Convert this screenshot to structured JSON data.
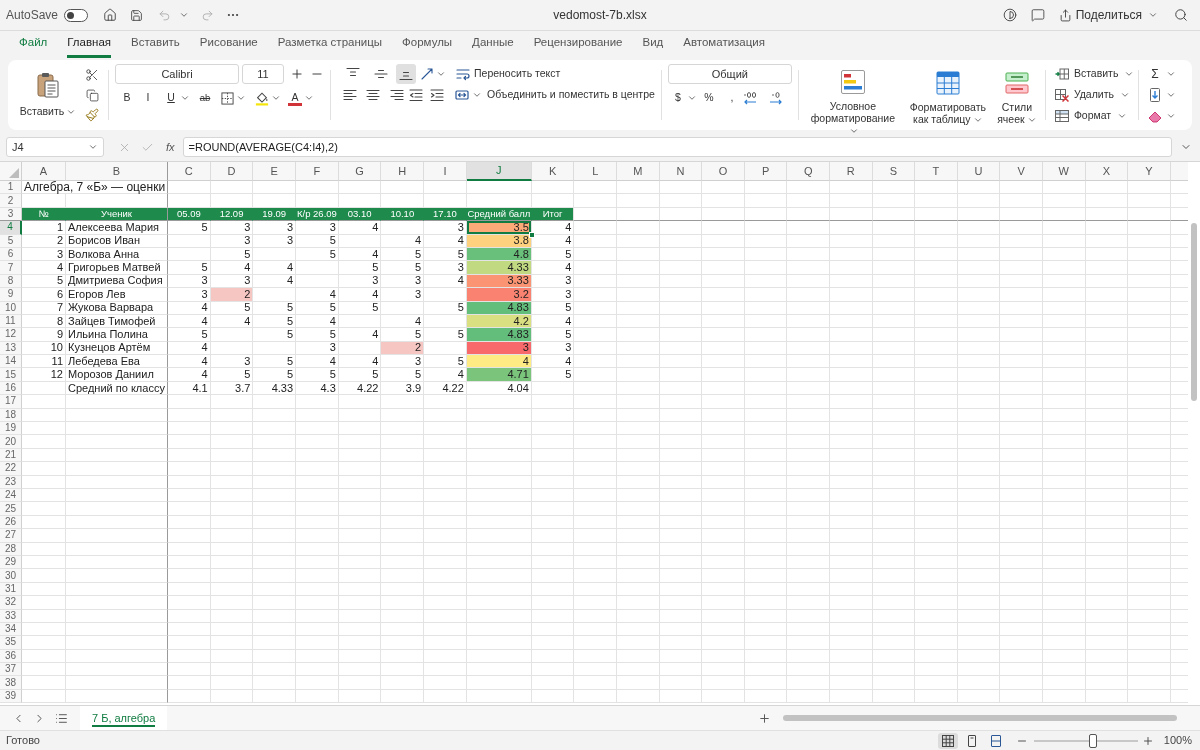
{
  "title_bar": {
    "autosave_label": "AutoSave",
    "autosave_on": false,
    "file_name": "vedomost-7b.xlsx",
    "share_label": "Поделиться"
  },
  "menu_tabs": [
    {
      "label": "Файл",
      "selected": false,
      "kind": "file"
    },
    {
      "label": "Главная",
      "selected": true,
      "kind": "tab"
    },
    {
      "label": "Вставить",
      "selected": false,
      "kind": "tab"
    },
    {
      "label": "Рисование",
      "selected": false,
      "kind": "tab"
    },
    {
      "label": "Разметка страницы",
      "selected": false,
      "kind": "tab"
    },
    {
      "label": "Формулы",
      "selected": false,
      "kind": "tab"
    },
    {
      "label": "Данные",
      "selected": false,
      "kind": "tab"
    },
    {
      "label": "Рецензирование",
      "selected": false,
      "kind": "tab"
    },
    {
      "label": "Вид",
      "selected": false,
      "kind": "tab"
    },
    {
      "label": "Автоматизация",
      "selected": false,
      "kind": "tab"
    }
  ],
  "ribbon": {
    "paste_label": "Вставить",
    "font_name": "Calibri",
    "font_size": "11",
    "font_glyphs": {
      "bold": "B",
      "italic": "I",
      "underline": "U",
      "strikethrough": "ab",
      "font_color": "A"
    },
    "vertical_align": [
      {
        "kind": "top",
        "selected": false
      },
      {
        "kind": "middle",
        "selected": false
      },
      {
        "kind": "bottom",
        "selected": true
      }
    ],
    "wrap_text_label": "Переносить текст",
    "merge_label": "Объединить и поместить в центре",
    "number_format": "Общий",
    "number_glyphs": {
      "currency": "$",
      "percent": "%",
      "comma": ","
    },
    "conditional_formatting_label": "Условное форматирование",
    "format_as_table_label": "Форматировать как таблицу",
    "cell_styles_label": "Стили ячеек",
    "cell_actions": [
      {
        "kind": "insert",
        "label": "Вставить"
      },
      {
        "kind": "delete",
        "label": "Удалить"
      },
      {
        "kind": "format",
        "label": "Формат"
      }
    ],
    "sum_glyph": "Σ"
  },
  "formula_bar": {
    "name_box": "J4",
    "fx_label": "fx",
    "formula": "=ROUND(AVERAGE(C4:I4),2)"
  },
  "sheet": {
    "columns": [
      {
        "label": "A",
        "selected": false
      },
      {
        "label": "B",
        "selected": false
      },
      {
        "label": "C",
        "selected": false
      },
      {
        "label": "D",
        "selected": false
      },
      {
        "label": "E",
        "selected": false
      },
      {
        "label": "F",
        "selected": false
      },
      {
        "label": "G",
        "selected": false
      },
      {
        "label": "H",
        "selected": false
      },
      {
        "label": "I",
        "selected": false
      },
      {
        "label": "J",
        "selected": true
      },
      {
        "label": "K",
        "selected": false
      },
      {
        "label": "L",
        "selected": false
      },
      {
        "label": "M",
        "selected": false
      },
      {
        "label": "N",
        "selected": false
      },
      {
        "label": "O",
        "selected": false
      },
      {
        "label": "P",
        "selected": false
      },
      {
        "label": "Q",
        "selected": false
      },
      {
        "label": "R",
        "selected": false
      },
      {
        "label": "S",
        "selected": false
      },
      {
        "label": "T",
        "selected": false
      },
      {
        "label": "U",
        "selected": false
      },
      {
        "label": "V",
        "selected": false
      },
      {
        "label": "W",
        "selected": false
      },
      {
        "label": "X",
        "selected": false
      },
      {
        "label": "Y",
        "selected": false
      }
    ],
    "rows": [
      {
        "label": "1",
        "selected": false,
        "kind": "title",
        "cells": [
          {
            "text": "Алгебра, 7 «Б» — оценки"
          }
        ]
      },
      {
        "label": "2",
        "selected": false,
        "kind": "empty"
      },
      {
        "label": "3",
        "selected": false,
        "kind": "header",
        "cells": [
          {
            "text": "№"
          },
          {
            "text": "Ученик"
          },
          {
            "text": "05.09"
          },
          {
            "text": "12.09"
          },
          {
            "text": "19.09"
          },
          {
            "text": "К/р 26.09"
          },
          {
            "text": "03.10"
          },
          {
            "text": "10.10"
          },
          {
            "text": "17.10"
          },
          {
            "text": "Средний балл"
          },
          {
            "text": "Итог"
          }
        ]
      },
      {
        "label": "4",
        "selected": true,
        "kind": "data",
        "cells": [
          {
            "text": "1"
          },
          {
            "text": "Алексеева Мария"
          },
          {
            "text": "5"
          },
          {
            "text": "3"
          },
          {
            "text": "3"
          },
          {
            "text": "3"
          },
          {
            "text": "4"
          },
          null,
          {
            "text": "3"
          },
          {
            "text": "3.5",
            "color": "#fcaa78"
          },
          {
            "text": "4"
          }
        ]
      },
      {
        "label": "5",
        "selected": false,
        "kind": "data",
        "cells": [
          {
            "text": "2"
          },
          {
            "text": "Борисов Иван"
          },
          null,
          {
            "text": "3"
          },
          {
            "text": "3"
          },
          {
            "text": "5"
          },
          null,
          {
            "text": "4"
          },
          {
            "text": "4"
          },
          {
            "text": "3.8",
            "color": "#fed17f"
          },
          {
            "text": "4"
          }
        ]
      },
      {
        "label": "6",
        "selected": false,
        "kind": "data",
        "cells": [
          {
            "text": "3"
          },
          {
            "text": "Волкова Анна"
          },
          null,
          {
            "text": "5"
          },
          null,
          {
            "text": "5"
          },
          {
            "text": "4"
          },
          {
            "text": "5"
          },
          {
            "text": "5"
          },
          {
            "text": "4.8",
            "color": "#69c07b"
          },
          {
            "text": "5"
          }
        ]
      },
      {
        "label": "7",
        "selected": false,
        "kind": "data",
        "cells": [
          {
            "text": "4"
          },
          {
            "text": "Григорьев Матвей"
          },
          {
            "text": "5"
          },
          {
            "text": "4"
          },
          {
            "text": "4"
          },
          null,
          {
            "text": "5"
          },
          {
            "text": "5"
          },
          {
            "text": "3"
          },
          {
            "text": "4.33",
            "color": "#c1d980"
          },
          {
            "text": "4"
          }
        ]
      },
      {
        "label": "8",
        "selected": false,
        "kind": "data",
        "cells": [
          {
            "text": "5"
          },
          {
            "text": "Дмитриева София"
          },
          {
            "text": "3"
          },
          {
            "text": "3"
          },
          {
            "text": "4"
          },
          null,
          {
            "text": "3"
          },
          {
            "text": "3"
          },
          {
            "text": "4"
          },
          {
            "text": "3.33",
            "color": "#fa9473"
          },
          {
            "text": "3"
          }
        ]
      },
      {
        "label": "9",
        "selected": false,
        "kind": "data",
        "cells": [
          {
            "text": "6"
          },
          {
            "text": "Егоров Лев"
          },
          {
            "text": "3"
          },
          {
            "text": "2",
            "color": "#f5c6c2"
          },
          null,
          {
            "text": "4"
          },
          {
            "text": "4"
          },
          {
            "text": "3"
          },
          null,
          {
            "text": "3.2",
            "color": "#f98370"
          },
          {
            "text": "3"
          }
        ]
      },
      {
        "label": "10",
        "selected": false,
        "kind": "data",
        "cells": [
          {
            "text": "7"
          },
          {
            "text": "Жукова Варвара"
          },
          {
            "text": "4"
          },
          {
            "text": "5"
          },
          {
            "text": "5"
          },
          {
            "text": "5"
          },
          {
            "text": "5"
          },
          null,
          {
            "text": "5"
          },
          {
            "text": "4.83",
            "color": "#63be7b"
          },
          {
            "text": "5"
          }
        ]
      },
      {
        "label": "11",
        "selected": false,
        "kind": "data",
        "cells": [
          {
            "text": "8"
          },
          {
            "text": "Зайцев Тимофей"
          },
          {
            "text": "4"
          },
          {
            "text": "4"
          },
          {
            "text": "5"
          },
          {
            "text": "4"
          },
          null,
          {
            "text": "4"
          },
          null,
          {
            "text": "4.2",
            "color": "#dae082"
          },
          {
            "text": "4"
          }
        ]
      },
      {
        "label": "12",
        "selected": false,
        "kind": "data",
        "cells": [
          {
            "text": "9"
          },
          {
            "text": "Ильина Полина"
          },
          {
            "text": "5"
          },
          null,
          {
            "text": "5"
          },
          {
            "text": "5"
          },
          {
            "text": "4"
          },
          {
            "text": "5"
          },
          {
            "text": "5"
          },
          {
            "text": "4.83",
            "color": "#63be7b"
          },
          {
            "text": "5"
          }
        ]
      },
      {
        "label": "13",
        "selected": false,
        "kind": "data",
        "cells": [
          {
            "text": "10"
          },
          {
            "text": "Кузнецов Артём"
          },
          {
            "text": "4"
          },
          null,
          null,
          {
            "text": "3"
          },
          null,
          {
            "text": "2",
            "color": "#f5c6c2"
          },
          null,
          {
            "text": "3",
            "color": "#f8696b"
          },
          {
            "text": "3"
          }
        ]
      },
      {
        "label": "14",
        "selected": false,
        "kind": "data",
        "cells": [
          {
            "text": "11"
          },
          {
            "text": "Лебедева Ева"
          },
          {
            "text": "4"
          },
          {
            "text": "3"
          },
          {
            "text": "5"
          },
          {
            "text": "4"
          },
          {
            "text": "4"
          },
          {
            "text": "3"
          },
          {
            "text": "5"
          },
          {
            "text": "4",
            "color": "#ffeb84"
          },
          {
            "text": "4"
          }
        ]
      },
      {
        "label": "15",
        "selected": false,
        "kind": "data",
        "cells": [
          {
            "text": "12"
          },
          {
            "text": "Морозов Даниил"
          },
          {
            "text": "4"
          },
          {
            "text": "5"
          },
          {
            "text": "5"
          },
          {
            "text": "5"
          },
          {
            "text": "5"
          },
          {
            "text": "5"
          },
          {
            "text": "4"
          },
          {
            "text": "4.71",
            "color": "#7ac47c"
          },
          {
            "text": "5"
          }
        ]
      },
      {
        "label": "16",
        "selected": false,
        "kind": "data",
        "cells": [
          null,
          {
            "text": "Средний по классу"
          },
          {
            "text": "4.1"
          },
          {
            "text": "3.7"
          },
          {
            "text": "4.33"
          },
          {
            "text": "4.3"
          },
          {
            "text": "4.22"
          },
          {
            "text": "3.9"
          },
          {
            "text": "4.22"
          },
          {
            "text": "4.04"
          },
          null
        ]
      },
      {
        "label": "17",
        "selected": false,
        "kind": "empty"
      },
      {
        "label": "18",
        "selected": false,
        "kind": "empty"
      },
      {
        "label": "19",
        "selected": false,
        "kind": "empty"
      },
      {
        "label": "20",
        "selected": false,
        "kind": "empty"
      },
      {
        "label": "21",
        "selected": false,
        "kind": "empty"
      },
      {
        "label": "22",
        "selected": false,
        "kind": "empty"
      },
      {
        "label": "23",
        "selected": false,
        "kind": "empty"
      },
      {
        "label": "24",
        "selected": false,
        "kind": "empty"
      },
      {
        "label": "25",
        "selected": false,
        "kind": "empty"
      },
      {
        "label": "26",
        "selected": false,
        "kind": "empty"
      },
      {
        "label": "27",
        "selected": false,
        "kind": "empty"
      },
      {
        "label": "28",
        "selected": false,
        "kind": "empty"
      },
      {
        "label": "29",
        "selected": false,
        "kind": "empty"
      },
      {
        "label": "30",
        "selected": false,
        "kind": "empty"
      },
      {
        "label": "31",
        "selected": false,
        "kind": "empty"
      },
      {
        "label": "32",
        "selected": false,
        "kind": "empty"
      },
      {
        "label": "33",
        "selected": false,
        "kind": "empty"
      },
      {
        "label": "34",
        "selected": false,
        "kind": "empty"
      },
      {
        "label": "35",
        "selected": false,
        "kind": "empty"
      },
      {
        "label": "36",
        "selected": false,
        "kind": "empty"
      },
      {
        "label": "37",
        "selected": false,
        "kind": "empty"
      },
      {
        "label": "38",
        "selected": false,
        "kind": "empty"
      },
      {
        "label": "39",
        "selected": false,
        "kind": "empty"
      }
    ]
  },
  "sheet_tabs": [
    {
      "label": "7 Б, алгебра",
      "selected": true
    }
  ],
  "status_bar": {
    "status": "Готово",
    "view_modes": [
      {
        "kind": "normal",
        "selected": true
      },
      {
        "kind": "page_layout",
        "selected": false
      },
      {
        "kind": "page_break",
        "selected": false
      }
    ],
    "zoom": {
      "level": 0.57,
      "reading": "100%"
    }
  }
}
